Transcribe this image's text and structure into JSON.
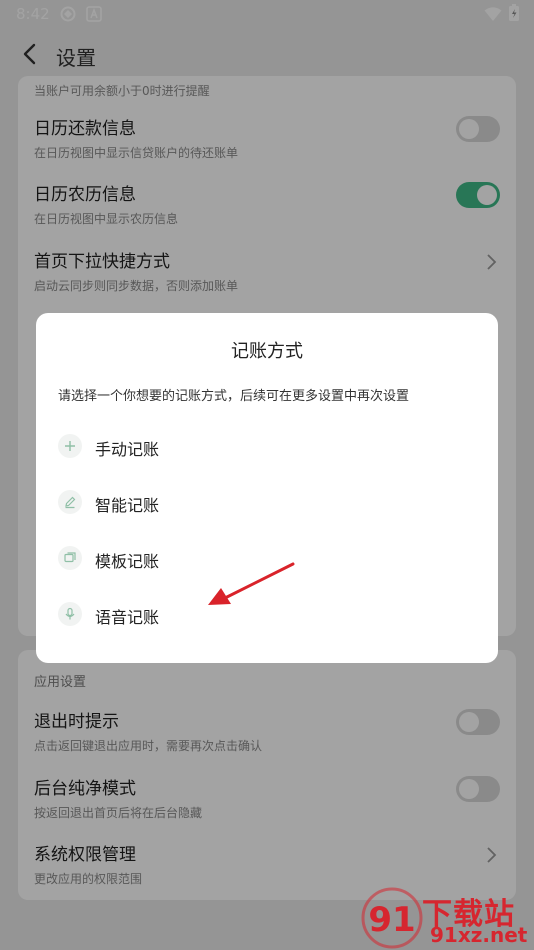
{
  "status_bar": {
    "time": "8:42"
  },
  "header": {
    "title": "设置"
  },
  "settings": {
    "top_hint": "当账户可用余额小于0时进行提醒",
    "items": [
      {
        "title": "日历还款信息",
        "subtitle": "在日历视图中显示信贷账户的待还账单",
        "control": "toggle",
        "on": false
      },
      {
        "title": "日历农历信息",
        "subtitle": "在日历视图中显示农历信息",
        "control": "toggle",
        "on": true
      },
      {
        "title": "首页下拉快捷方式",
        "subtitle": "启动云同步则同步数据，否则添加账单",
        "control": "chevron"
      }
    ],
    "app_section_title": "应用设置",
    "app_items": [
      {
        "title": "退出时提示",
        "subtitle": "点击返回键退出应用时，需要再次点击确认",
        "control": "toggle",
        "on": false
      },
      {
        "title": "后台纯净模式",
        "subtitle": "按返回退出首页后将在后台隐藏",
        "control": "toggle",
        "on": false
      },
      {
        "title": "系统权限管理",
        "subtitle": "更改应用的权限范围",
        "control": "chevron"
      }
    ]
  },
  "dialog": {
    "title": "记账方式",
    "description": "请选择一个你想要的记账方式，后续可在更多设置中再次设置",
    "options": [
      {
        "label": "手动记账",
        "icon": "plus-icon"
      },
      {
        "label": "智能记账",
        "icon": "pencil-icon"
      },
      {
        "label": "模板记账",
        "icon": "template-icon"
      },
      {
        "label": "语音记账",
        "icon": "microphone-icon"
      }
    ]
  },
  "watermark": {
    "brand_cn": "下载站",
    "brand_url": "91xz.net",
    "logo_text": "91"
  },
  "colors": {
    "toggle_on": "#3fb987",
    "dialog_icon": "#8fbfa6",
    "arrow": "#d9232a",
    "watermark": "#d6262f"
  }
}
